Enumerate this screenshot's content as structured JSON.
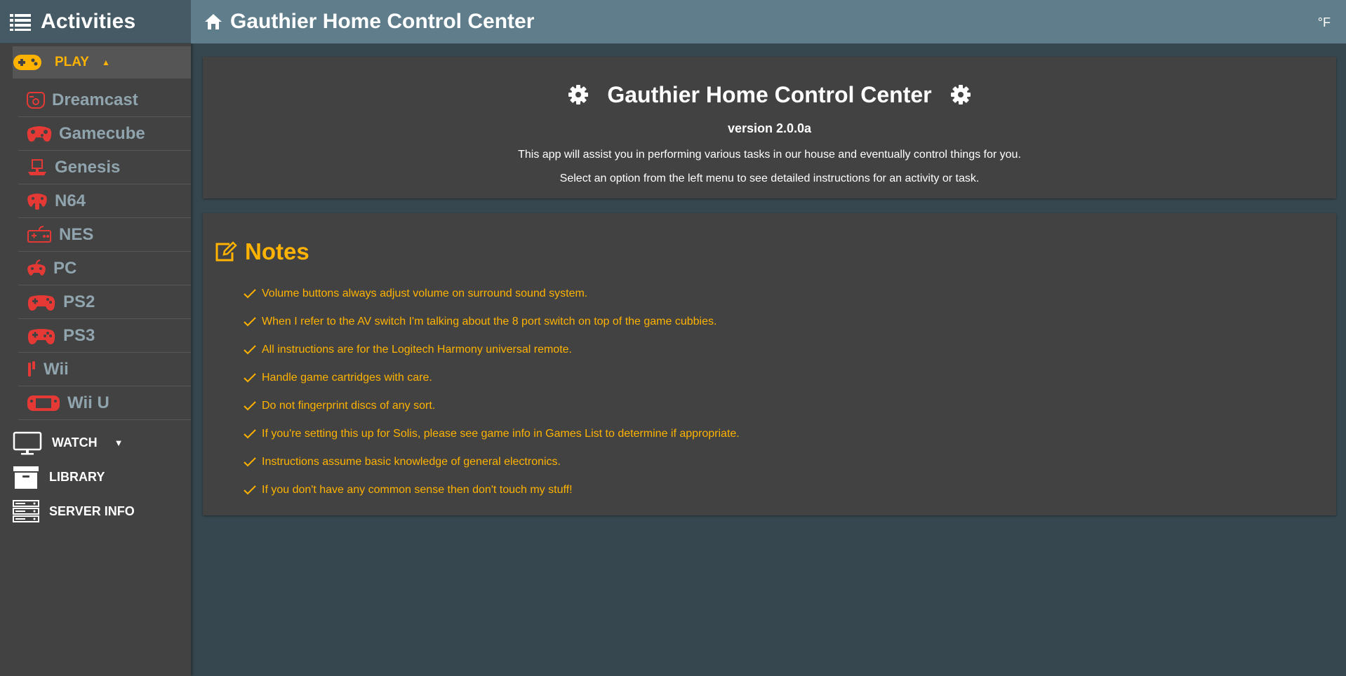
{
  "sidebar": {
    "title": "Activities",
    "play": {
      "label": "PLAY"
    },
    "games": [
      {
        "label": "Dreamcast",
        "icon": "dreamcast-controller-icon"
      },
      {
        "label": "Gamecube",
        "icon": "gamecube-controller-icon"
      },
      {
        "label": "Genesis",
        "icon": "genesis-controller-icon"
      },
      {
        "label": "N64",
        "icon": "n64-controller-icon"
      },
      {
        "label": "NES",
        "icon": "nes-controller-icon"
      },
      {
        "label": "PC",
        "icon": "pc-controller-icon"
      },
      {
        "label": "PS2",
        "icon": "ps2-controller-icon"
      },
      {
        "label": "PS3",
        "icon": "ps3-controller-icon"
      },
      {
        "label": "Wii",
        "icon": "wii-remote-icon"
      },
      {
        "label": "Wii U",
        "icon": "wiiu-gamepad-icon"
      }
    ],
    "watch": {
      "label": "WATCH"
    },
    "library": {
      "label": "LIBRARY"
    },
    "server_info": {
      "label": "SERVER INFO"
    }
  },
  "topbar": {
    "title": "Gauthier Home Control Center",
    "temp_unit": "°F"
  },
  "welcome": {
    "title": "Gauthier Home Control Center",
    "version": "version 2.0.0a",
    "description": "This app will assist you in performing various tasks in our house and eventually control things for you.",
    "instruction": "Select an option from the left menu to see detailed instructions for an activity or task."
  },
  "notes": {
    "title": "Notes",
    "items": [
      "Volume buttons always adjust volume on surround sound system.",
      "When I refer to the AV switch I'm talking about the 8 port switch on top of the game cubbies.",
      "All instructions are for the Logitech Harmony universal remote.",
      "Handle game cartridges with care.",
      "Do not fingerprint discs of any sort.",
      "If you're setting this up for Solis, please see game info in Games List to determine if appropriate.",
      "Instructions assume basic knowledge of general electronics.",
      "If you don't have any common sense then don't touch my stuff!"
    ]
  },
  "colors": {
    "accent": "#ffb300",
    "controller_red": "#e53935",
    "sidebar_bg": "#424242",
    "topbar_bg": "#607d8b",
    "page_bg": "#37474f",
    "submenu_text": "#90a4ae"
  }
}
